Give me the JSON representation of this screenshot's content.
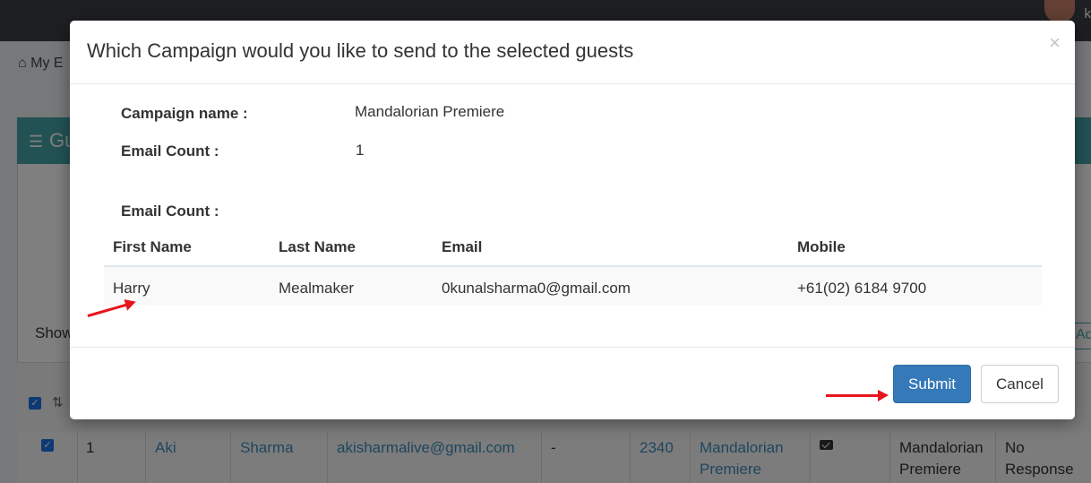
{
  "topbar": {
    "user_initial": "k"
  },
  "breadcrumb": {
    "label": "My E"
  },
  "box": {
    "title": "Gu",
    "icon": "list-icon"
  },
  "table_controls": {
    "show_label": "Show",
    "add_label": "Ad"
  },
  "background_row": {
    "index": "1",
    "first_name": "Aki",
    "last_name": "Sharma",
    "email": "akisharmalive@gmail.com",
    "dash": "-",
    "code": "2340",
    "campaign_line1": "Mandalorian",
    "campaign_line2": "Premiere",
    "campaign2_line1": "Mandalorian",
    "campaign2_line2": "Premiere",
    "status_line1": "No",
    "status_line2": "Response"
  },
  "modal": {
    "title": "Which Campaign would you like to send to the selected guests",
    "close_label": "×",
    "campaign_name_label": "Campaign name :",
    "campaign_name_value": "Mandalorian Premiere",
    "email_count_label": "Email Count :",
    "email_count_value": "1",
    "email_count_label_2": "Email Count :",
    "columns": [
      "First Name",
      "Last Name",
      "Email",
      "Mobile"
    ],
    "rows": [
      [
        "Harry",
        "Mealmaker",
        "0kunalsharma0@gmail.com",
        "+61(02) 6184 9700"
      ]
    ],
    "submit_label": "Submit",
    "cancel_label": "Cancel"
  },
  "colors": {
    "primary": "#3579b9",
    "header_teal": "#47a5a9",
    "arrow_red": "#e8141c",
    "link": "#3c8dbc"
  }
}
